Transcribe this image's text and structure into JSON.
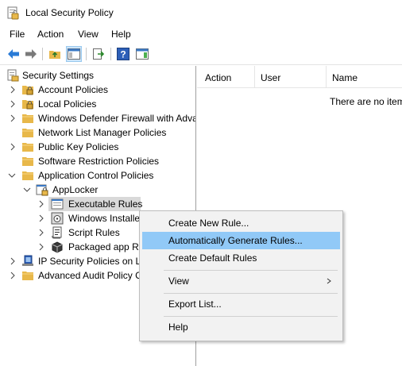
{
  "window": {
    "title": "Local Security Policy"
  },
  "menubar": {
    "items": [
      "File",
      "Action",
      "View",
      "Help"
    ]
  },
  "tree": [
    {
      "label": "Security Settings",
      "expanded": true,
      "icon": "security-settings-icon"
    },
    {
      "label": "Account Policies",
      "icon": "folder-lock-icon"
    },
    {
      "label": "Local Policies",
      "icon": "folder-lock-icon"
    },
    {
      "label": "Windows Defender Firewall with Adva",
      "icon": "folder-icon"
    },
    {
      "label": "Network List Manager Policies",
      "icon": "folder-icon"
    },
    {
      "label": "Public Key Policies",
      "icon": "folder-icon"
    },
    {
      "label": "Software Restriction Policies",
      "icon": "folder-icon"
    },
    {
      "label": "Application Control Policies",
      "expanded": true,
      "icon": "folder-icon"
    },
    {
      "label": "AppLocker",
      "expanded": true,
      "icon": "applocker-icon"
    },
    {
      "label": "Executable Rules",
      "selected": true,
      "icon": "executable-rules-icon"
    },
    {
      "label": "Windows Installe",
      "icon": "installer-icon"
    },
    {
      "label": "Script Rules",
      "icon": "script-icon"
    },
    {
      "label": "Packaged app Ru",
      "icon": "package-icon"
    },
    {
      "label": "IP Security Policies on Lo",
      "icon": "ip-security-icon"
    },
    {
      "label": "Advanced Audit Policy C",
      "icon": "folder-icon"
    }
  ],
  "list": {
    "columns": [
      "Action",
      "User",
      "Name"
    ],
    "empty_message": "There are no item"
  },
  "context_menu": {
    "items": [
      {
        "label": "Create New Rule..."
      },
      {
        "label": "Automatically Generate Rules...",
        "highlighted": true
      },
      {
        "label": "Create Default Rules"
      },
      {
        "label": "View",
        "submenu": true
      },
      {
        "label": "Export List..."
      },
      {
        "label": "Help"
      }
    ]
  },
  "colors": {
    "highlight": "#91c9f7",
    "selection": "#d9d9d9",
    "folder": "#e8b84a"
  }
}
